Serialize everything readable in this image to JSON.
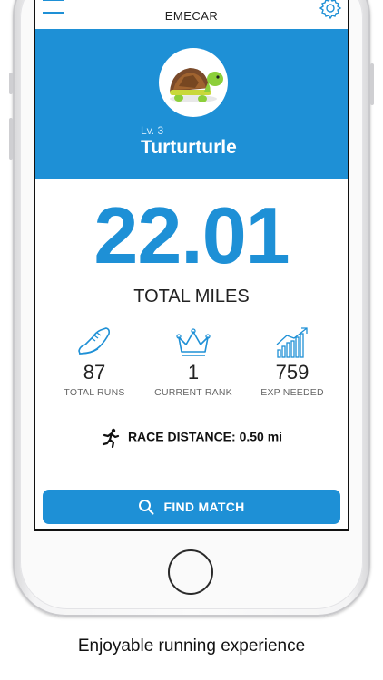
{
  "app": {
    "title": "EMECAR"
  },
  "profile": {
    "level": "Lv. 3",
    "name": "Turturturle",
    "avatar_icon": "turtle-icon"
  },
  "summary": {
    "total_miles": "22.01",
    "total_miles_label": "TOTAL MILES"
  },
  "stats": [
    {
      "icon": "running-shoe-icon",
      "value": "87",
      "label": "TOTAL RUNS"
    },
    {
      "icon": "crown-icon",
      "value": "1",
      "label": "CURRENT RANK"
    },
    {
      "icon": "growth-chart-icon",
      "value": "759",
      "label": "EXP NEEDED"
    }
  ],
  "race": {
    "icon": "runner-icon",
    "label": "RACE DISTANCE: 0.50 mi"
  },
  "actions": {
    "find_match": "FIND MATCH"
  },
  "caption": "Enjoyable running experience",
  "colors": {
    "accent": "#1e90d6",
    "text": "#222222",
    "muted": "#666666"
  }
}
